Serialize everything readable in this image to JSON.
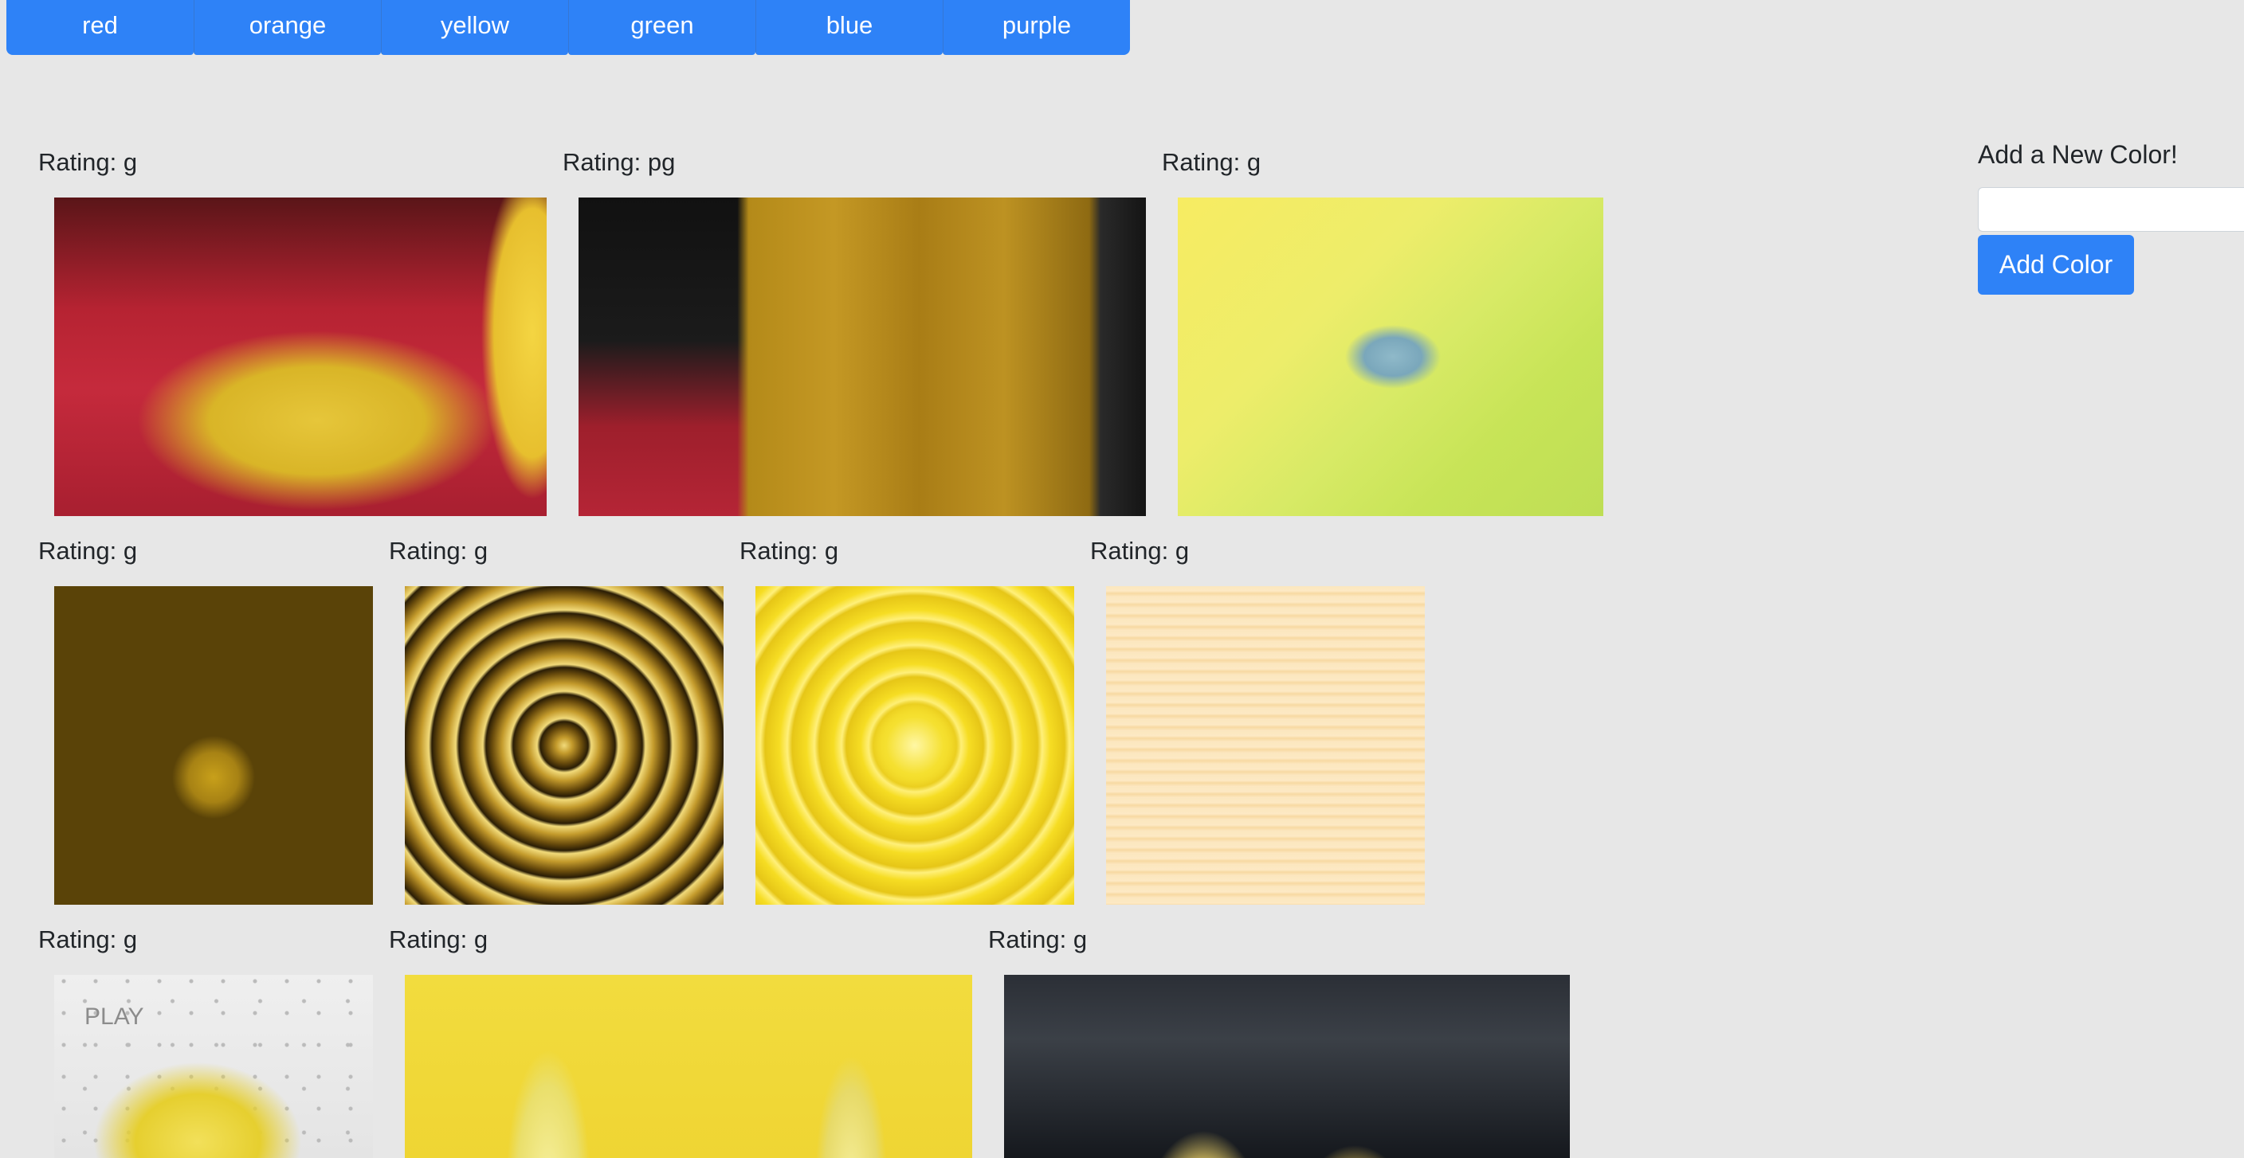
{
  "color_buttons": [
    {
      "label": "red"
    },
    {
      "label": "orange"
    },
    {
      "label": "yellow"
    },
    {
      "label": "green"
    },
    {
      "label": "blue"
    },
    {
      "label": "purple"
    }
  ],
  "gifs": [
    {
      "rating": "Rating: g",
      "image": "yellow-gown-red-carpet"
    },
    {
      "rating": "Rating: pg",
      "image": "gold-dress-red-carpet"
    },
    {
      "rating": "Rating: g",
      "image": "toy-in-yellow-room"
    },
    {
      "rating": "Rating: g",
      "image": "disco-ball-yellow-hands"
    },
    {
      "rating": "Rating: g",
      "image": "golden-spiral"
    },
    {
      "rating": "Rating: g",
      "image": "yellow-lemon-spiral"
    },
    {
      "rating": "Rating: g",
      "image": "pale-yellow-texture"
    },
    {
      "rating": "Rating: g",
      "image": "lemons-in-basket",
      "overlay_text": "PLAY"
    },
    {
      "rating": "Rating: g",
      "image": "people-yellow-backdrop"
    },
    {
      "rating": "Rating: g",
      "image": "music-video-still"
    }
  ],
  "add_color": {
    "title": "Add a New Color!",
    "input_value": "",
    "input_placeholder": "",
    "button_label": "Add Color"
  },
  "colors": {
    "accent": "#2e82f7",
    "page_background": "#e7e7e7"
  }
}
